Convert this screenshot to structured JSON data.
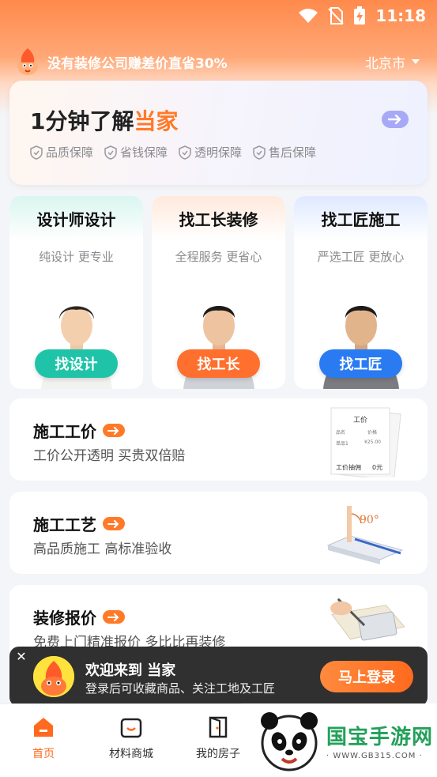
{
  "status_bar": {
    "time": "11:18"
  },
  "header": {
    "slogan": "没有装修公司赚差价直省30%",
    "city": "北京市"
  },
  "promo": {
    "title_prefix": "1分钟了解",
    "title_accent": "当家",
    "guarantees": [
      "品质保障",
      "省钱保障",
      "透明保障",
      "售后保障"
    ],
    "colors": {
      "accent": "#ff7a28",
      "arrow_bg": "#a8a9f6"
    }
  },
  "services": [
    {
      "title": "设计师设计",
      "subtitle": "纯设计 更专业",
      "button": "找设计",
      "button_color": "#1fc4a8",
      "band_color": "#e3f8f4"
    },
    {
      "title": "找工长装修",
      "subtitle": "全程服务 更省心",
      "button": "找工长",
      "button_color": "#ff6f2e",
      "band_color": "#fff0e5"
    },
    {
      "title": "找工匠施工",
      "subtitle": "严选工匠 更放心",
      "button": "找工匠",
      "button_color": "#2a7bf2",
      "band_color": "#e6efff"
    }
  ],
  "info_cards": [
    {
      "title": "施工工价",
      "subtitle": "工价公开透明 买贵双倍赔",
      "illus_label": "工价",
      "rows": [
        [
          "品名",
          "价格"
        ],
        [
          "单品1",
          "¥25.00"
        ],
        [
          "工价抽佣",
          "0元"
        ]
      ]
    },
    {
      "title": "施工工艺",
      "subtitle": "高品质施工 高标准验收",
      "illus_label": "90°"
    },
    {
      "title": "装修报价",
      "subtitle": "免费上门精准报价 多比比再装修"
    }
  ],
  "login_banner": {
    "title": "欢迎来到 当家",
    "subtitle": "登录后可收藏商品、关注工地及工匠",
    "button": "马上登录"
  },
  "tab_bar": {
    "items": [
      {
        "label": "首页",
        "icon": "home-icon",
        "active": true
      },
      {
        "label": "材料商城",
        "icon": "shop-bag-icon",
        "active": false
      },
      {
        "label": "我的房子",
        "icon": "door-icon",
        "active": false
      }
    ],
    "active_color": "#ff6a1e"
  },
  "watermark": {
    "text": "国宝手游网",
    "url": "· WWW.GB315.COM ·"
  }
}
